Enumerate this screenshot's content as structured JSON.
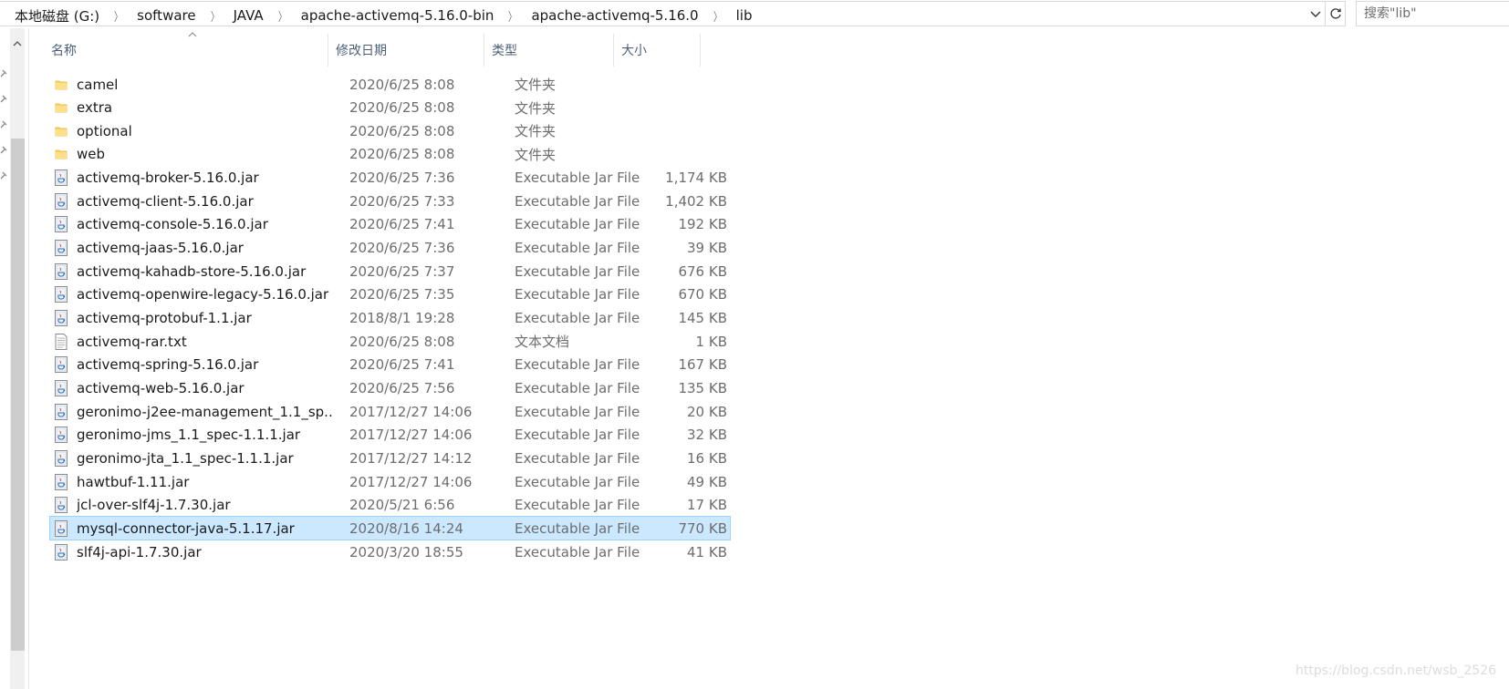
{
  "address_bar": {
    "crumbs": [
      "本地磁盘 (G:)",
      "software",
      "JAVA",
      "apache-activemq-5.16.0-bin",
      "apache-activemq-5.16.0",
      "lib"
    ],
    "separator": "〉"
  },
  "search": {
    "placeholder": "搜索\"lib\""
  },
  "columns": {
    "name": "名称",
    "date": "修改日期",
    "type": "类型",
    "size": "大小"
  },
  "rows": [
    {
      "name": "camel",
      "date": "2020/6/25 8:08",
      "type": "文件夹",
      "size": "",
      "icon": "folder-icon"
    },
    {
      "name": "extra",
      "date": "2020/6/25 8:08",
      "type": "文件夹",
      "size": "",
      "icon": "folder-icon"
    },
    {
      "name": "optional",
      "date": "2020/6/25 8:08",
      "type": "文件夹",
      "size": "",
      "icon": "folder-icon"
    },
    {
      "name": "web",
      "date": "2020/6/25 8:08",
      "type": "文件夹",
      "size": "",
      "icon": "folder-icon"
    },
    {
      "name": "activemq-broker-5.16.0.jar",
      "date": "2020/6/25 7:36",
      "type": "Executable Jar File",
      "size": "1,174 KB",
      "icon": "jar-file-icon"
    },
    {
      "name": "activemq-client-5.16.0.jar",
      "date": "2020/6/25 7:33",
      "type": "Executable Jar File",
      "size": "1,402 KB",
      "icon": "jar-file-icon"
    },
    {
      "name": "activemq-console-5.16.0.jar",
      "date": "2020/6/25 7:41",
      "type": "Executable Jar File",
      "size": "192 KB",
      "icon": "jar-file-icon"
    },
    {
      "name": "activemq-jaas-5.16.0.jar",
      "date": "2020/6/25 7:36",
      "type": "Executable Jar File",
      "size": "39 KB",
      "icon": "jar-file-icon"
    },
    {
      "name": "activemq-kahadb-store-5.16.0.jar",
      "date": "2020/6/25 7:37",
      "type": "Executable Jar File",
      "size": "676 KB",
      "icon": "jar-file-icon"
    },
    {
      "name": "activemq-openwire-legacy-5.16.0.jar",
      "date": "2020/6/25 7:35",
      "type": "Executable Jar File",
      "size": "670 KB",
      "icon": "jar-file-icon"
    },
    {
      "name": "activemq-protobuf-1.1.jar",
      "date": "2018/8/1 19:28",
      "type": "Executable Jar File",
      "size": "145 KB",
      "icon": "jar-file-icon"
    },
    {
      "name": "activemq-rar.txt",
      "date": "2020/6/25 8:08",
      "type": "文本文档",
      "size": "1 KB",
      "icon": "text-file-icon"
    },
    {
      "name": "activemq-spring-5.16.0.jar",
      "date": "2020/6/25 7:41",
      "type": "Executable Jar File",
      "size": "167 KB",
      "icon": "jar-file-icon"
    },
    {
      "name": "activemq-web-5.16.0.jar",
      "date": "2020/6/25 7:56",
      "type": "Executable Jar File",
      "size": "135 KB",
      "icon": "jar-file-icon"
    },
    {
      "name": "geronimo-j2ee-management_1.1_sp...",
      "date": "2017/12/27 14:06",
      "type": "Executable Jar File",
      "size": "20 KB",
      "icon": "jar-file-icon"
    },
    {
      "name": "geronimo-jms_1.1_spec-1.1.1.jar",
      "date": "2017/12/27 14:06",
      "type": "Executable Jar File",
      "size": "32 KB",
      "icon": "jar-file-icon"
    },
    {
      "name": "geronimo-jta_1.1_spec-1.1.1.jar",
      "date": "2017/12/27 14:12",
      "type": "Executable Jar File",
      "size": "16 KB",
      "icon": "jar-file-icon"
    },
    {
      "name": "hawtbuf-1.11.jar",
      "date": "2017/12/27 14:06",
      "type": "Executable Jar File",
      "size": "49 KB",
      "icon": "jar-file-icon"
    },
    {
      "name": "jcl-over-slf4j-1.7.30.jar",
      "date": "2020/5/21 6:56",
      "type": "Executable Jar File",
      "size": "17 KB",
      "icon": "jar-file-icon"
    },
    {
      "name": "mysql-connector-java-5.1.17.jar",
      "date": "2020/8/16 14:24",
      "type": "Executable Jar File",
      "size": "770 KB",
      "icon": "jar-file-icon",
      "selected": true
    },
    {
      "name": "slf4j-api-1.7.30.jar",
      "date": "2020/3/20 18:55",
      "type": "Executable Jar File",
      "size": "41 KB",
      "icon": "jar-file-icon"
    }
  ],
  "watermark": "https://blog.csdn.net/wsb_2526"
}
